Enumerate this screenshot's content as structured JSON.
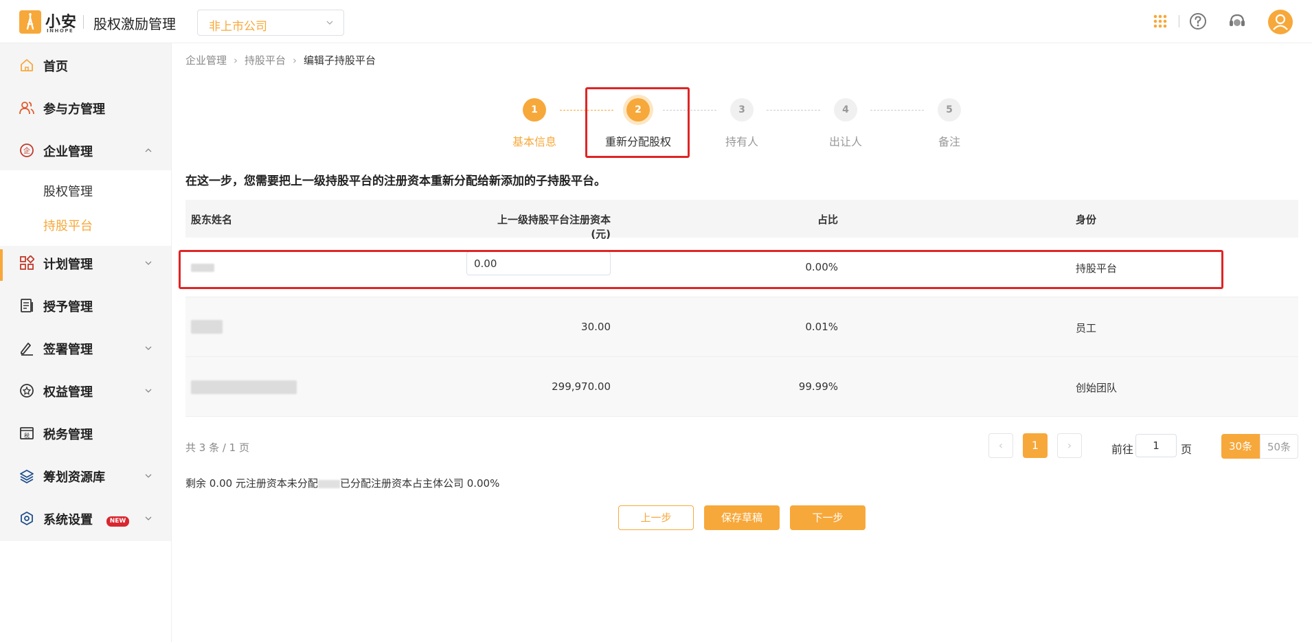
{
  "header": {
    "brand_cn": "小安",
    "brand_en": "INHOPE",
    "app_title": "股权激励管理",
    "company_select": "非上市公司",
    "accent": "#f7a83a"
  },
  "sidebar": {
    "items": [
      {
        "label": "首页",
        "icon": "home-icon"
      },
      {
        "label": "参与方管理",
        "icon": "users-icon"
      },
      {
        "label": "企业管理",
        "icon": "company-icon"
      },
      {
        "label": "计划管理",
        "icon": "grid-icon"
      },
      {
        "label": "授予管理",
        "icon": "document-icon"
      },
      {
        "label": "签署管理",
        "icon": "pen-icon"
      },
      {
        "label": "权益管理",
        "icon": "badge-icon"
      },
      {
        "label": "税务管理",
        "icon": "tax-icon"
      },
      {
        "label": "筹划资源库",
        "icon": "layers-icon",
        "badge": "NEW"
      },
      {
        "label": "系统设置",
        "icon": "settings-icon"
      }
    ],
    "sub_items": [
      "股权管理",
      "持股平台"
    ]
  },
  "breadcrumb": [
    "企业管理",
    "持股平台",
    "编辑子持股平台"
  ],
  "steps": [
    {
      "num": "1",
      "label": "基本信息"
    },
    {
      "num": "2",
      "label": "重新分配股权"
    },
    {
      "num": "3",
      "label": "持有人"
    },
    {
      "num": "4",
      "label": "出让人"
    },
    {
      "num": "5",
      "label": "备注"
    }
  ],
  "instruction": "在这一步，您需要把上一级持股平台的注册资本重新分配给新添加的子持股平台。",
  "table": {
    "headers": [
      "股东姓名",
      "上一级持股平台注册资本(元)",
      "占比",
      "身份"
    ],
    "rows": [
      {
        "capital": "0.00",
        "ratio": "0.00%",
        "role": "持股平台"
      },
      {
        "capital": "30.00",
        "ratio": "0.01%",
        "role": "员工"
      },
      {
        "capital": "299,970.00",
        "ratio": "99.99%",
        "role": "创始团队"
      }
    ]
  },
  "pagination": {
    "total": "共 3 条 / 1 页",
    "current_page": "1",
    "goto_label": "前往",
    "goto_value": "1",
    "page_unit": "页",
    "size_active": "30条",
    "size_other": "50条"
  },
  "summary": {
    "part1": "剩余 0.00 元注册资本未分配",
    "part2": "已分配注册资本占主体公司 0.00%"
  },
  "buttons": {
    "prev": "上一步",
    "draft": "保存草稿",
    "next": "下一步"
  }
}
